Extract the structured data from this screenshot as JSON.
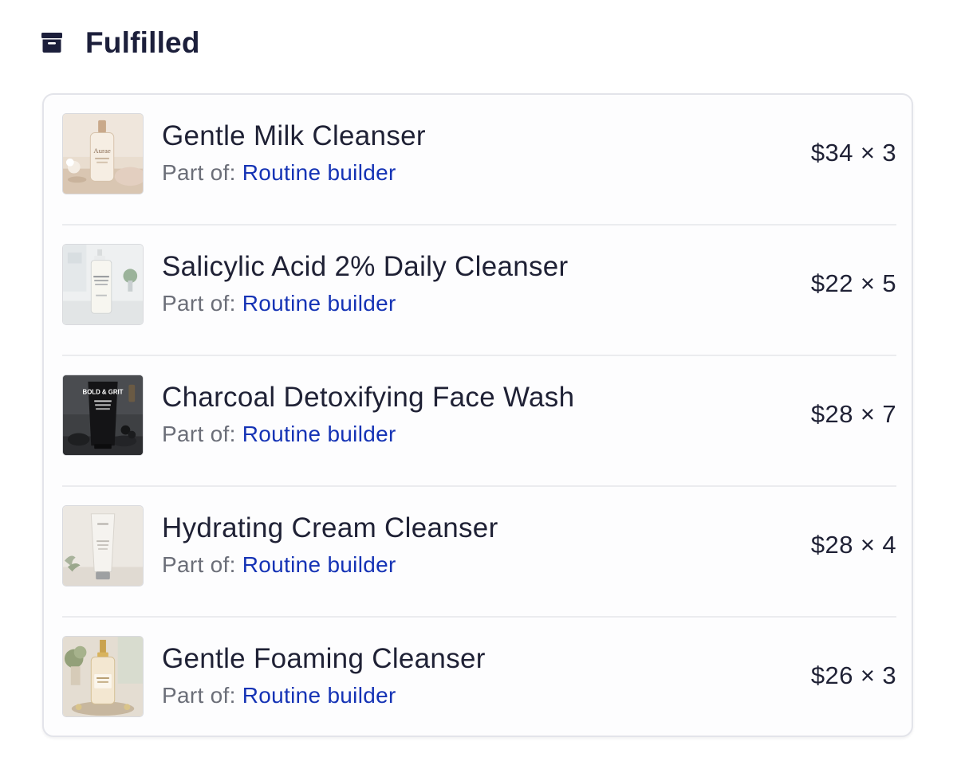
{
  "section": {
    "title": "Fulfilled",
    "icon": "archive-icon"
  },
  "items": [
    {
      "name": "Gentle Milk Cleanser",
      "part_of_label": "Part of: ",
      "part_of_link": "Routine builder",
      "price_qty": "$34 × 3",
      "thumbnail": "gentle-milk-cleanser-image",
      "thumbnail_text": "Aurae"
    },
    {
      "name": "Salicylic Acid 2% Daily Cleanser",
      "part_of_label": "Part of: ",
      "part_of_link": "Routine builder",
      "price_qty": "$22 × 5",
      "thumbnail": "salicylic-acid-cleanser-image"
    },
    {
      "name": "Charcoal Detoxifying Face Wash",
      "part_of_label": "Part of: ",
      "part_of_link": "Routine builder",
      "price_qty": "$28 × 7",
      "thumbnail": "charcoal-face-wash-image",
      "thumbnail_text": "BOLD & GRIT"
    },
    {
      "name": "Hydrating Cream Cleanser",
      "part_of_label": "Part of: ",
      "part_of_link": "Routine builder",
      "price_qty": "$28 × 4",
      "thumbnail": "hydrating-cream-cleanser-image"
    },
    {
      "name": "Gentle Foaming Cleanser",
      "part_of_label": "Part of: ",
      "part_of_link": "Routine builder",
      "price_qty": "$26 × 3",
      "thumbnail": "gentle-foaming-cleanser-image"
    }
  ],
  "colors": {
    "title": "#1c1f3b",
    "link": "#1533b5",
    "muted": "#6b6e78",
    "card_border": "#e3e4ea"
  }
}
